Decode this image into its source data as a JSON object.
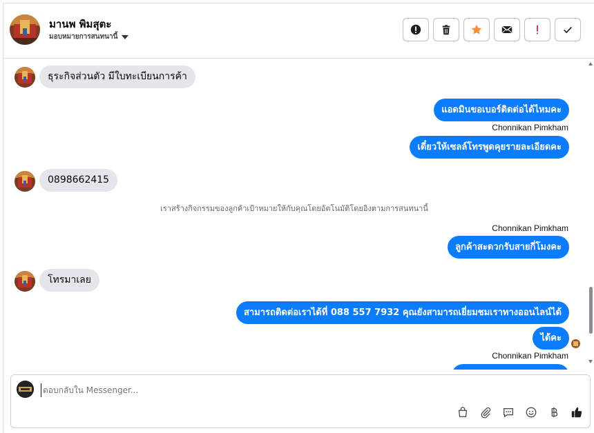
{
  "contact": {
    "name": "มานพ พิมสุตะ",
    "assign_label": "มอบหมายการสนทนานี้"
  },
  "actions": [
    {
      "name": "mark-spam-button",
      "icon": "alert-circle-icon"
    },
    {
      "name": "delete-button",
      "icon": "trash-icon"
    },
    {
      "name": "star-button",
      "icon": "star-icon",
      "color": "#f7923a"
    },
    {
      "name": "mark-unread-button",
      "icon": "envelope-icon"
    },
    {
      "name": "follow-up-button",
      "icon": "exclamation-icon",
      "color": "#e41e3f"
    },
    {
      "name": "mark-done-button",
      "icon": "check-icon"
    }
  ],
  "messages": {
    "m1": "ธุระกิจส่วนตัว มีใบทะเบียนการค้า",
    "m2": "แอดมินขอเบอร์ติดต่อได้ไหมคะ",
    "sender1": "Chonnikan Pimkham",
    "m3": "เดี๋ยวให้เซลล์โทรพูดคุยรายละเอียดคะ",
    "m4": "0898662415",
    "system": "เราสร้างกิจกรรมของลูกค้าเป้าหมายให้กับคุณโดยอัตโนมัติโดยอิงตามการสนทนานี้",
    "sender2": "Chonnikan Pimkham",
    "m5": "ลูกค้าสะดวกรับสายกี่โมงคะ",
    "m6": "โทรมาเลย",
    "m7": "สามารถติดต่อเราได้ที่ 088 557 7932 คุณยังสามารถเยี่ยมชมเราทางออนไลน์ได้",
    "m8": "ได้คะ",
    "sender3": "Chonnikan Pimkham"
  },
  "composer": {
    "placeholder": "ตอบกลับใน Messenger..."
  },
  "composer_tools": [
    "shopping-bag-icon",
    "paperclip-icon",
    "saved-reply-icon",
    "emoji-icon",
    "baht-icon",
    "thumbs-up-icon"
  ],
  "colors": {
    "outgoing_bubble": "#0a7cff",
    "incoming_bubble": "#e4e6eb"
  }
}
